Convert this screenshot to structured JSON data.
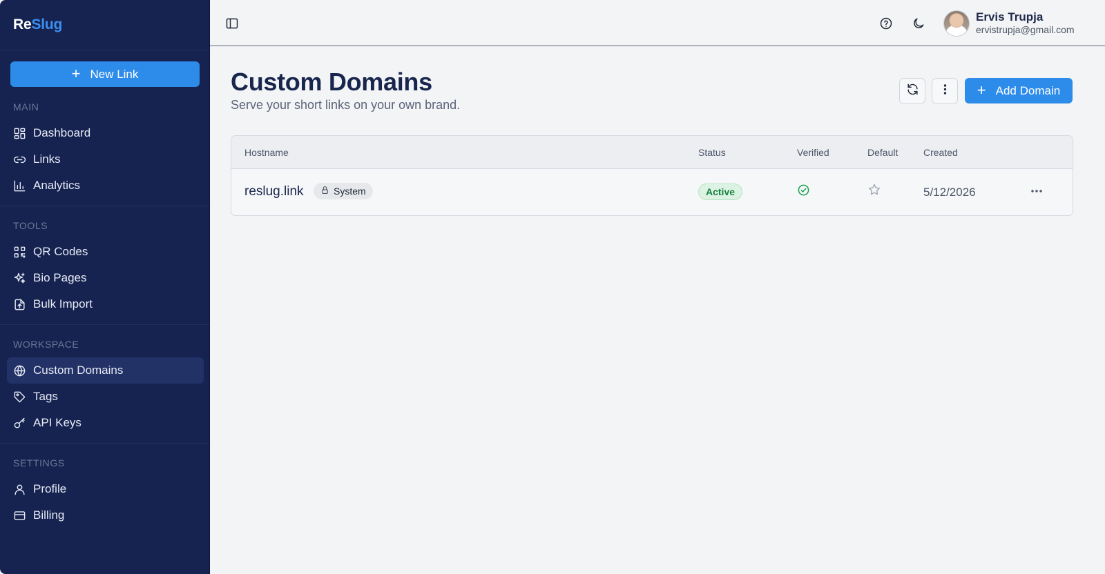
{
  "brand": {
    "part1": "Re",
    "part2": "Slug"
  },
  "sidebar": {
    "new_link_label": "New Link",
    "sections": [
      {
        "label": "MAIN",
        "items": [
          {
            "label": "Dashboard",
            "icon": "dashboard-icon"
          },
          {
            "label": "Links",
            "icon": "link-icon"
          },
          {
            "label": "Analytics",
            "icon": "analytics-icon"
          }
        ]
      },
      {
        "label": "TOOLS",
        "items": [
          {
            "label": "QR Codes",
            "icon": "qr-code-icon"
          },
          {
            "label": "Bio Pages",
            "icon": "sparkles-icon"
          },
          {
            "label": "Bulk Import",
            "icon": "file-upload-icon"
          }
        ]
      },
      {
        "label": "WORKSPACE",
        "items": [
          {
            "label": "Custom Domains",
            "icon": "globe-icon",
            "active": true
          },
          {
            "label": "Tags",
            "icon": "tag-icon"
          },
          {
            "label": "API Keys",
            "icon": "key-icon"
          }
        ]
      },
      {
        "label": "SETTINGS",
        "items": [
          {
            "label": "Profile",
            "icon": "user-icon"
          },
          {
            "label": "Billing",
            "icon": "credit-card-icon"
          }
        ]
      }
    ]
  },
  "header": {
    "user_name": "Ervis Trupja",
    "user_email": "ervistrupja@gmail.com"
  },
  "page": {
    "title": "Custom Domains",
    "subtitle": "Serve your short links on your own brand.",
    "add_domain_label": "Add Domain"
  },
  "table": {
    "columns": [
      "Hostname",
      "Status",
      "Verified",
      "Default",
      "Created"
    ],
    "rows": [
      {
        "hostname": "reslug.link",
        "badge": "System",
        "status": "Active",
        "verified": true,
        "default": false,
        "created": "5/12/2026"
      }
    ]
  },
  "colors": {
    "sidebar_bg": "#162350",
    "accent": "#2d8cea",
    "status_active": "#15803d"
  }
}
